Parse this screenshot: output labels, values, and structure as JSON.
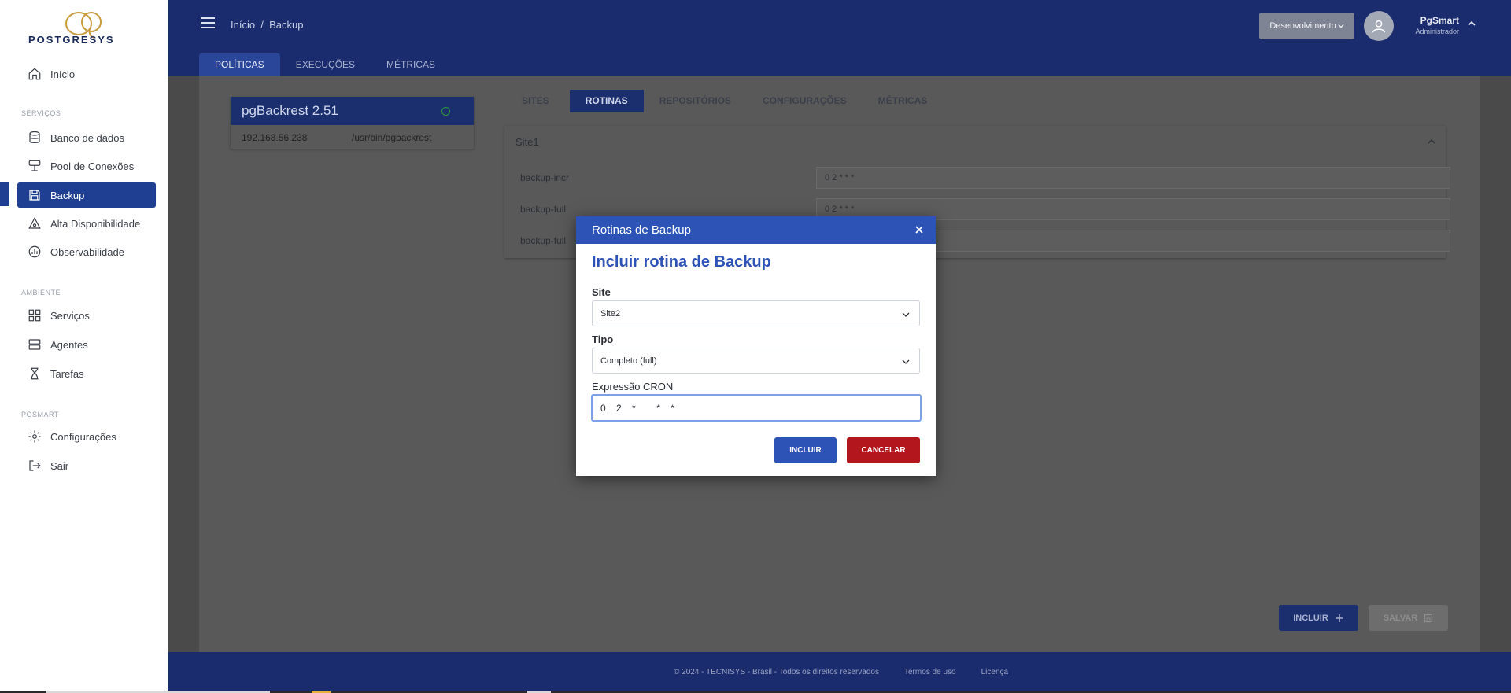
{
  "brand": {
    "name": "POSTGRESYS"
  },
  "sidebar": {
    "items_top": [
      {
        "label": "Início",
        "icon": "home-icon"
      }
    ],
    "sections": [
      {
        "title": "SERVIÇOS",
        "items": [
          {
            "label": "Banco de dados",
            "icon": "database-icon"
          },
          {
            "label": "Pool de Conexões",
            "icon": "pool-icon"
          },
          {
            "label": "Backup",
            "icon": "save-icon",
            "active": true
          },
          {
            "label": "Alta Disponibilidade",
            "icon": "triangle-icon"
          },
          {
            "label": "Observabilidade",
            "icon": "chart-icon"
          }
        ]
      },
      {
        "title": "AMBIENTE",
        "items": [
          {
            "label": "Serviços",
            "icon": "grid-icon"
          },
          {
            "label": "Agentes",
            "icon": "server-icon"
          },
          {
            "label": "Tarefas",
            "icon": "hourglass-icon"
          }
        ]
      },
      {
        "title": "PGSMART",
        "items": [
          {
            "label": "Configurações",
            "icon": "gear-icon"
          },
          {
            "label": "Sair",
            "icon": "logout-icon"
          }
        ]
      }
    ]
  },
  "header": {
    "breadcrumb": "Início  /  Backup",
    "environment": "Desenvolvimento",
    "user_name": "PgSmart",
    "user_role": "Administrador",
    "tabs": [
      "POLÍTICAS",
      "EXECUÇÕES",
      "MÉTRICAS"
    ],
    "active_tab": "POLÍTICAS"
  },
  "tool": {
    "title": "pgBackrest 2.51",
    "ip": "192.168.56.238",
    "path": "/usr/bin/pgbackrest"
  },
  "subtabs": [
    "SITES",
    "ROTINAS",
    "REPOSITÓRIOS",
    "CONFIGURAÇÕES",
    "MÉTRICAS"
  ],
  "active_subtab": "ROTINAS",
  "site_panel": {
    "title": "Site1",
    "routines": [
      {
        "label": "backup-incr",
        "value": "0 2 * * *"
      },
      {
        "label": "backup-full",
        "value": "0 2 * * *"
      },
      {
        "label": "backup-full",
        "value": ""
      }
    ]
  },
  "actions": {
    "incluir": "INCLUIR",
    "salvar": "SALVAR"
  },
  "footer": {
    "copyright": "© 2024 - TECNISYS - Brasil - Todos os direitos reservados",
    "terms": "Termos de uso",
    "license": "Licença"
  },
  "modal": {
    "header": "Rotinas de Backup",
    "title": "Incluir rotina de Backup",
    "site_label": "Site",
    "site_value": "Site2",
    "tipo_label": "Tipo",
    "tipo_value": "Completo (full)",
    "cron_label": "Expressão CRON",
    "cron_value": "0    2    *        *    *",
    "incluir": "INCLUIR",
    "cancelar": "CANCELAR"
  },
  "colors": {
    "primary": "#2d53b7",
    "danger": "#b3161c",
    "navy": "#1a2c6e"
  }
}
